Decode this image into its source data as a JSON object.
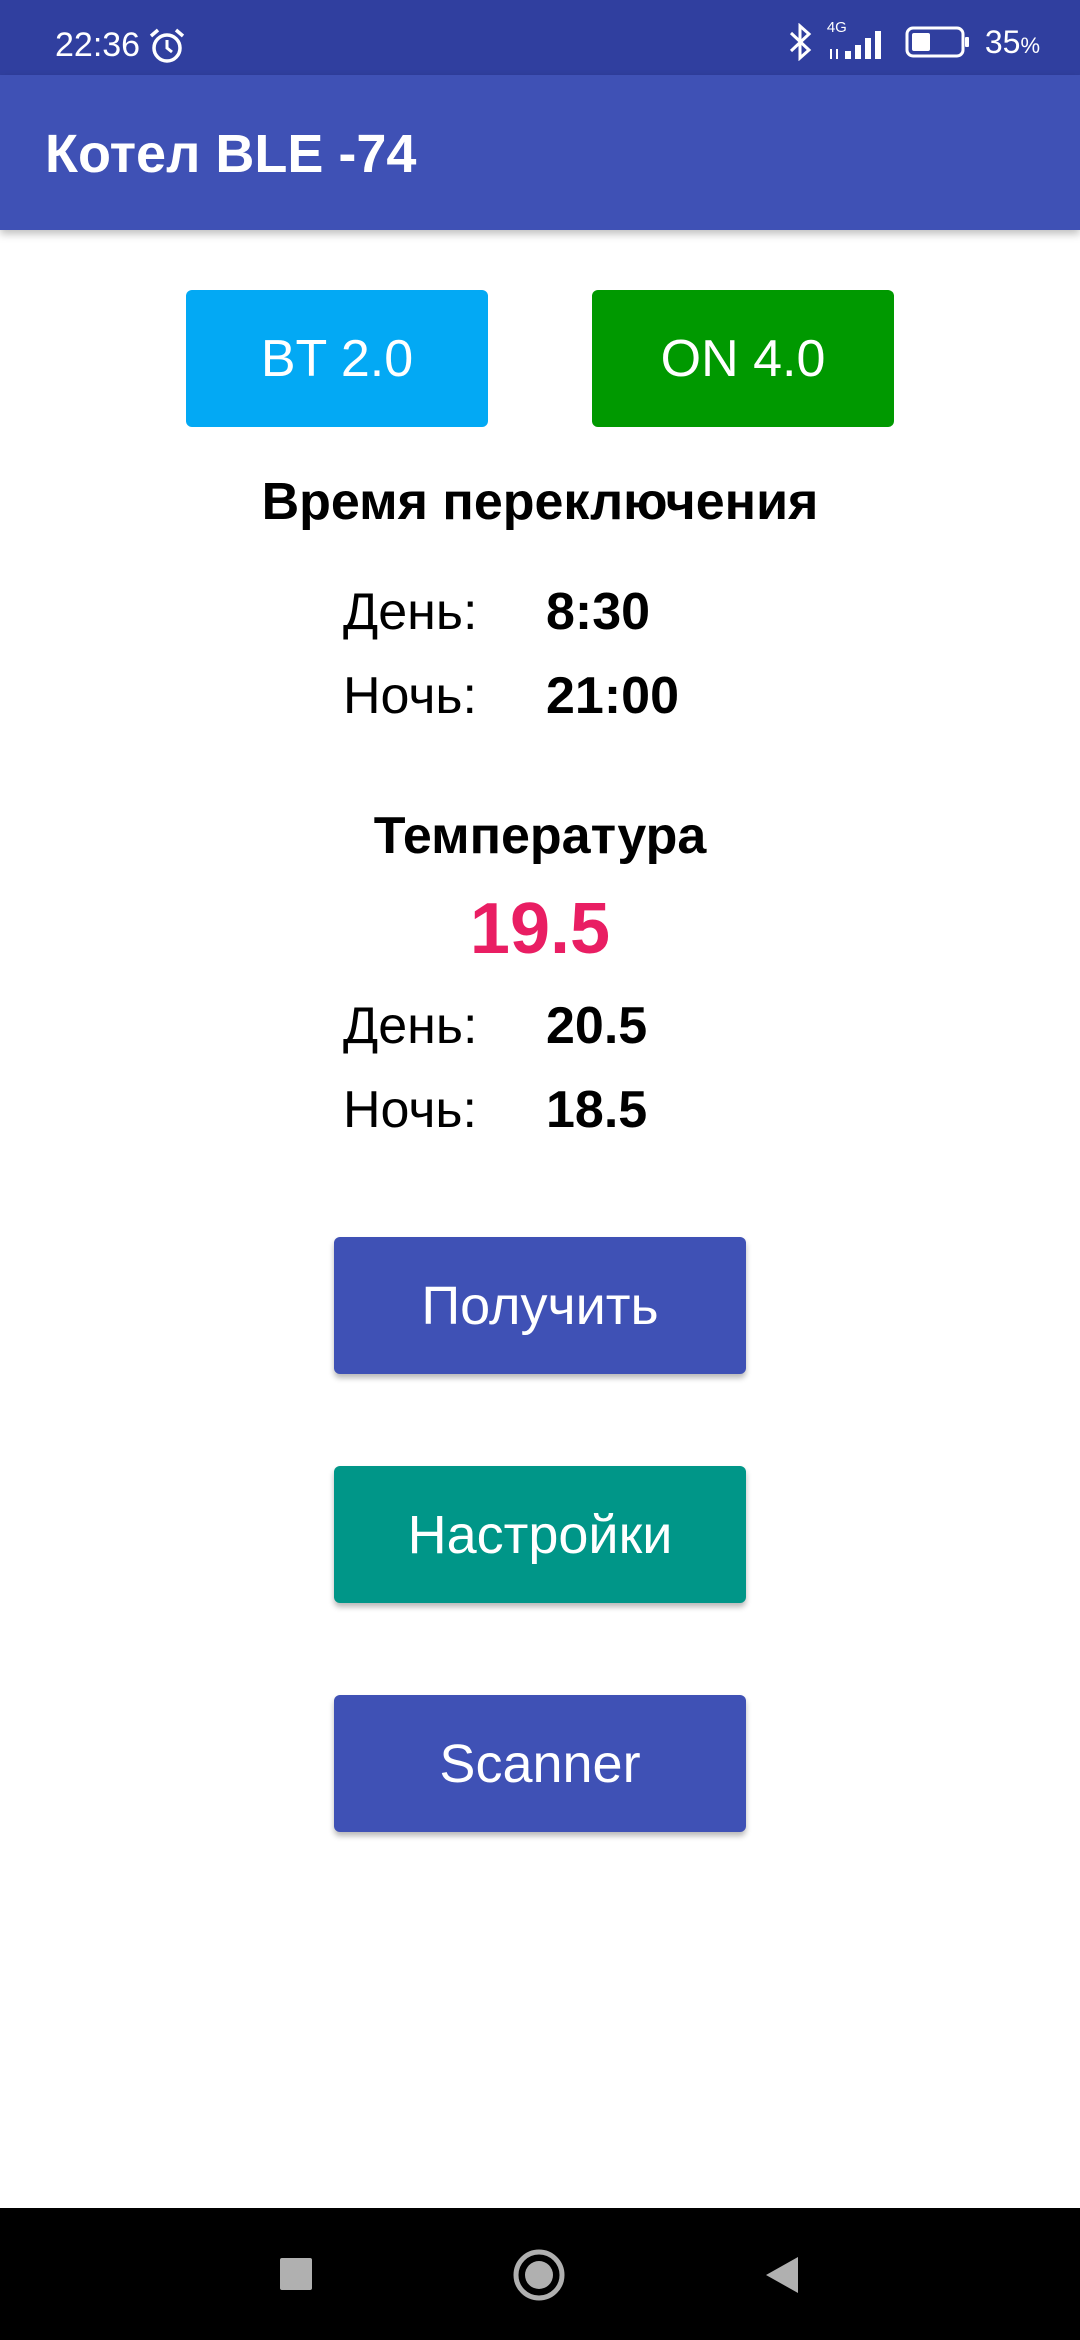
{
  "status_bar": {
    "time": "22:36",
    "network": "4G",
    "battery_percent": "35",
    "battery_unit": "%",
    "icons": [
      "alarm-icon",
      "bluetooth-icon",
      "signal-icon",
      "battery-icon"
    ]
  },
  "app_bar": {
    "title": "Котел BLE -74",
    "color": "#3f51b5"
  },
  "status_chips": {
    "bt": {
      "label": "BT 2.0",
      "color": "#03a9f4"
    },
    "on": {
      "label": "ON 4.0",
      "color": "#009900"
    }
  },
  "switch_time": {
    "heading": "Время переключения",
    "day_label": "День:",
    "day_value": "8:30",
    "night_label": "Ночь:",
    "night_value": "21:00"
  },
  "temperature": {
    "heading": "Температура",
    "current": "19.5",
    "current_color": "#e91e63",
    "day_label": "День:",
    "day_value": "20.5",
    "night_label": "Ночь:",
    "night_value": "18.5"
  },
  "buttons": {
    "get": {
      "label": "Получить",
      "color": "#3f51b5"
    },
    "settings": {
      "label": "Настройки",
      "color": "#009688"
    },
    "scanner": {
      "label": "Scanner",
      "color": "#3f51b5"
    }
  },
  "nav_bar": {
    "icons": [
      "recents-icon",
      "home-icon",
      "back-icon"
    ]
  }
}
